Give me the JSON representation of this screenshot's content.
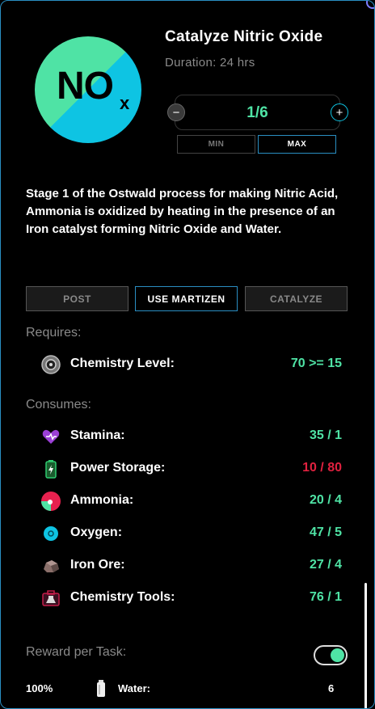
{
  "header": {
    "logo_text": "NO",
    "logo_subscript": "x",
    "title": "Catalyze Nitric Oxide",
    "duration": "Duration: 24 hrs"
  },
  "stepper": {
    "value": "1/6",
    "minus_symbol": "−",
    "plus_symbol": "+",
    "min_label": "MIN",
    "max_label": "MAX"
  },
  "description": "Stage 1 of the Ostwald process for making Nitric Acid, Ammonia is oxidized by heating in the presence of an Iron catalyst forming Nitric Oxide and Water.",
  "actions": {
    "post": "POST",
    "use_martizen": "USE MARTIZEN",
    "catalyze": "CATALYZE"
  },
  "requires": {
    "label": "Requires:",
    "items": [
      {
        "icon": "chemistry-level-icon",
        "label": "Chemistry Level:",
        "value": "70 >= 15",
        "color": "#4fe3a5"
      }
    ]
  },
  "consumes": {
    "label": "Consumes:",
    "items": [
      {
        "icon": "stamina-icon",
        "label": "Stamina:",
        "value": "35 / 1",
        "color": "#4fe3a5"
      },
      {
        "icon": "power-storage-icon",
        "label": "Power Storage:",
        "value": "10 / 80",
        "color": "#e0213f"
      },
      {
        "icon": "ammonia-icon",
        "label": "Ammonia:",
        "value": "20 / 4",
        "color": "#4fe3a5"
      },
      {
        "icon": "oxygen-icon",
        "label": "Oxygen:",
        "value": "47 / 5",
        "color": "#4fe3a5"
      },
      {
        "icon": "iron-ore-icon",
        "label": "Iron Ore:",
        "value": "27 / 4",
        "color": "#4fe3a5"
      },
      {
        "icon": "chemistry-tools-icon",
        "label": "Chemistry Tools:",
        "value": "76 / 1",
        "color": "#4fe3a5"
      }
    ]
  },
  "reward": {
    "label": "Reward per Task:",
    "toggle_on": true,
    "percent": "100%",
    "item_icon": "water-icon",
    "item_name": "Water:",
    "quantity": "6"
  }
}
